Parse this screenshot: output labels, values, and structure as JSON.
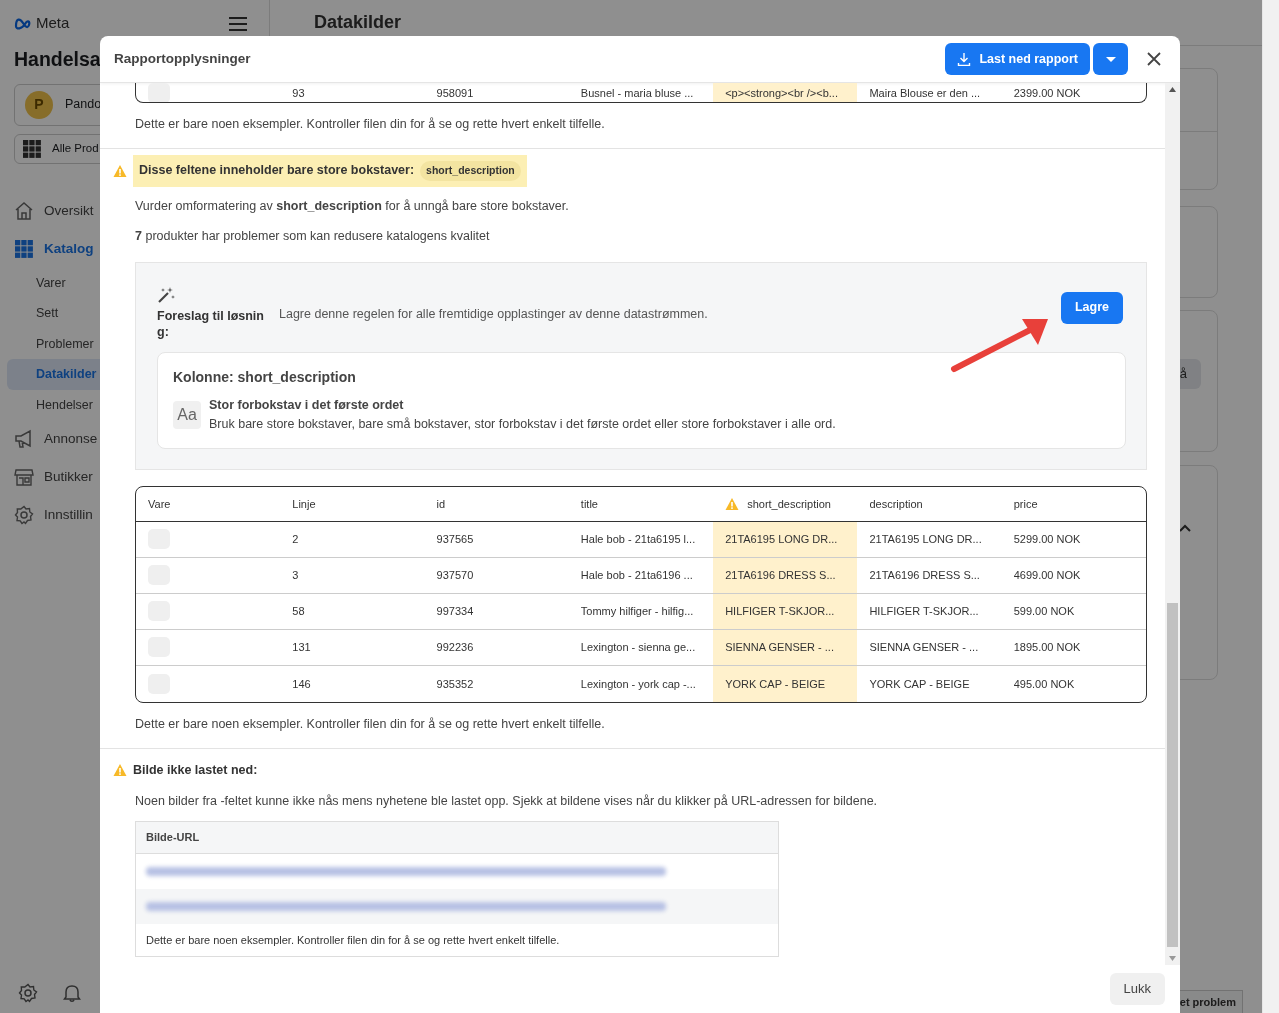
{
  "app": {
    "brand": "Meta",
    "business": "Handelsa",
    "account": {
      "initial": "P",
      "name": "Pando"
    },
    "catalog_picker": "Alle Prod",
    "nav": [
      {
        "label": "Oversikt",
        "selected": false
      },
      {
        "label": "Katalog",
        "selected": true,
        "children": [
          {
            "label": "Varer",
            "selected": false
          },
          {
            "label": "Sett",
            "selected": false
          },
          {
            "label": "Problemer",
            "selected": false
          },
          {
            "label": "Datakilder",
            "selected": true
          },
          {
            "label": "Hendelser",
            "selected": false
          }
        ]
      },
      {
        "label": "Annonse",
        "selected": false
      },
      {
        "label": "Butikker",
        "selected": false
      },
      {
        "label": "Innstillin",
        "selected": false
      }
    ],
    "page_title": "Datakilder",
    "card_button": "å",
    "report_button": "et problem"
  },
  "modal": {
    "title": "Rapportopplysninger",
    "download_button": "Last ned rapport",
    "previous_rows": [
      [
        {
          "text": "",
          "flagged": false
        },
        {
          "text": "93",
          "flagged": false
        },
        {
          "text": "958091",
          "flagged": false
        },
        {
          "text": "Busnel - maria bluse ...",
          "flagged": false
        },
        {
          "text": "<p><strong><br /><b...",
          "flagged": true
        },
        {
          "text": "Maira Blouse er den ...",
          "flagged": false
        },
        {
          "text": "2399.00 NOK",
          "flagged": false
        }
      ]
    ],
    "previous_note": "Dette er bare noen eksempler. Kontroller filen din for å se og rette hvert enkelt tilfelle.",
    "issue": {
      "heading": "Disse feltene inneholder bare store bokstaver:",
      "field_tag": "short_description",
      "advice": "Vurder omformatering av **short_description** for å unngå bare store bokstaver.",
      "count_text": "**7** produkter har problemer som kan redusere katalogens kvalitet",
      "suggestion": {
        "label": "Foreslag til løsning:",
        "text": "Lagre denne regelen for alle fremtidige opplastinger av denne datastrømmen.",
        "save_button": "Lagre",
        "column_title": "Kolonne: short_description",
        "rule_icon": "Aa",
        "rule_title": "Stor forbokstav i det første ordet",
        "rule_text": "Bruk bare store bokstaver, bare små bokstaver, stor forbokstav i det første ordet eller store forbokstaver i alle ord."
      },
      "table": {
        "columns": [
          {
            "label": "Vare",
            "flagged": false
          },
          {
            "label": "Linje",
            "flagged": false
          },
          {
            "label": "id",
            "flagged": false
          },
          {
            "label": "title",
            "flagged": false
          },
          {
            "label": "short_description",
            "flagged": true
          },
          {
            "label": "description",
            "flagged": false
          },
          {
            "label": "price",
            "flagged": false
          }
        ],
        "rows": [
          [
            "",
            "2",
            "937565",
            "Hale bob - 21ta6195 l...",
            "21TA6195 LONG DR...",
            "21TA6195 LONG DR...",
            "5299.00 NOK"
          ],
          [
            "",
            "3",
            "937570",
            "Hale bob - 21ta6196 ...",
            "21TA6196 DRESS S...",
            "21TA6196 DRESS S...",
            "4699.00 NOK"
          ],
          [
            "",
            "58",
            "997334",
            "Tommy hilfiger - hilfig...",
            "HILFIGER T-SKJOR...",
            "HILFIGER T-SKJOR...",
            "599.00 NOK"
          ],
          [
            "",
            "131",
            "992236",
            "Lexington - sienna ge...",
            "SIENNA GENSER - ...",
            "SIENNA GENSER - ...",
            "1895.00 NOK"
          ],
          [
            "",
            "146",
            "935352",
            "Lexington - york cap -...",
            "YORK CAP - BEIGE",
            "YORK CAP - BEIGE",
            "495.00 NOK"
          ]
        ]
      },
      "note": "Dette er bare noen eksempler. Kontroller filen din for å se og rette hvert enkelt tilfelle."
    },
    "image_issue": {
      "heading": "Bilde ikke lastet ned:",
      "text": "Noen bilder fra -feltet kunne ikke nås mens nyhetene ble lastet opp. Sjekk at bildene vises når du klikker på URL-adressen for bildene.",
      "table_header": "Bilde-URL",
      "table_note": "Dette er bare noen eksempler. Kontroller filen din for å se og rette hvert enkelt tilfelle."
    },
    "close_button": "Lukk"
  }
}
